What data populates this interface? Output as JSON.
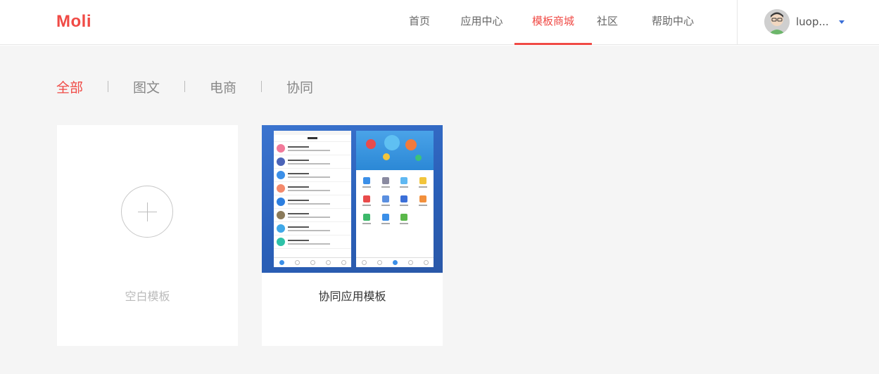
{
  "header": {
    "logo_text": "Moli",
    "nav": [
      {
        "label": "首页",
        "active": false
      },
      {
        "label": "应用中心",
        "active": false
      },
      {
        "label": "模板商城",
        "active": true
      },
      {
        "label": "社区",
        "active": false
      },
      {
        "label": "帮助中心",
        "active": false
      }
    ],
    "user": {
      "name": "luop..."
    }
  },
  "filters": [
    {
      "label": "全部",
      "active": true
    },
    {
      "label": "图文",
      "active": false
    },
    {
      "label": "电商",
      "active": false
    },
    {
      "label": "协同",
      "active": false
    }
  ],
  "templates": [
    {
      "label": "空白模板",
      "type": "blank"
    },
    {
      "label": "协同应用模板",
      "type": "collab"
    }
  ],
  "colors": {
    "accent": "#f04a45",
    "thumb_blue": "#2f68c2"
  }
}
